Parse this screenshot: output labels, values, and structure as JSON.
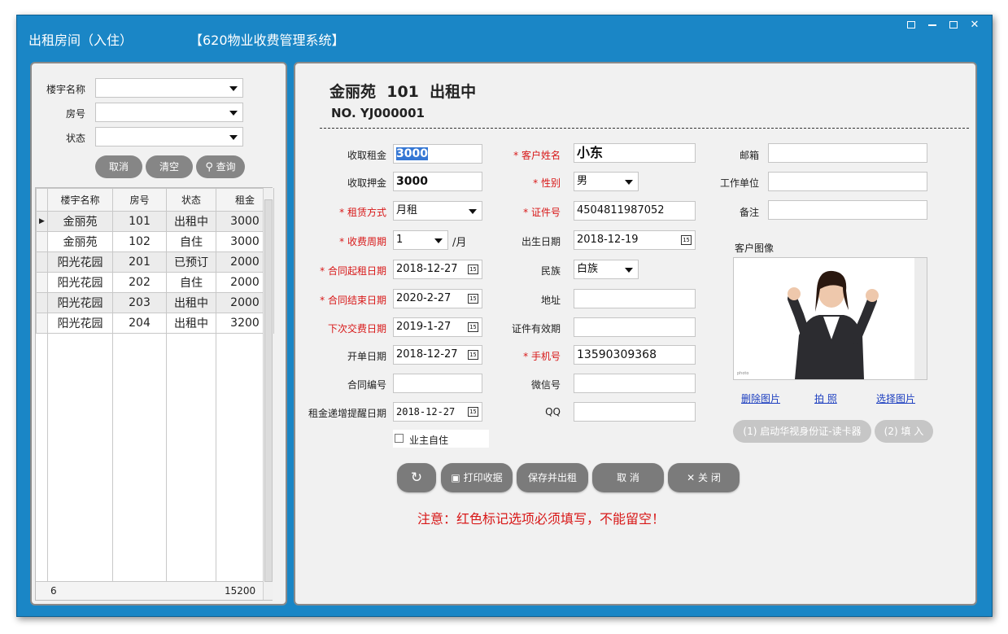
{
  "window": {
    "title": "出租房间（入住）",
    "system": "【620物业收费管理系统】"
  },
  "filter": {
    "building_label": "楼宇名称",
    "room_label": "房号",
    "status_label": "状态",
    "building_value": "",
    "room_value": "",
    "status_value": "",
    "cancel_label": "取消",
    "clear_label": "清空",
    "query_label": "查询"
  },
  "table": {
    "columns": [
      "楼宇名称",
      "房号",
      "状态",
      "租金"
    ],
    "rows": [
      [
        "金丽苑",
        "101",
        "出租中",
        "3000"
      ],
      [
        "金丽苑",
        "102",
        "自住",
        "3000"
      ],
      [
        "阳光花园",
        "201",
        "已预订",
        "2000"
      ],
      [
        "阳光花园",
        "202",
        "自住",
        "2000"
      ],
      [
        "阳光花园",
        "203",
        "出租中",
        "2000"
      ],
      [
        "阳光花园",
        "204",
        "出租中",
        "3200"
      ]
    ],
    "footer_count": "6",
    "footer_total": "15200"
  },
  "header": {
    "title": "金丽苑  101  出租中",
    "number": "NO. YJ000001"
  },
  "form": {
    "rent_label": "收取租金",
    "rent_value": "3000",
    "deposit_label": "收取押金",
    "deposit_value": "3000",
    "lease_type_label": "* 租赁方式",
    "lease_type_value": "月租",
    "cycle_label": "* 收费周期",
    "cycle_value": "1",
    "cycle_unit": "/月",
    "contract_start_label": "* 合同起租日期",
    "contract_start_value": "2018-12-27",
    "contract_end_label": "* 合同结束日期",
    "contract_end_value": "2020-2-27",
    "next_pay_label": "下次交费日期",
    "next_pay_value": "2019-1-27",
    "open_date_label": "开单日期",
    "open_date_value": "2018-12-27",
    "contract_no_label": "合同编号",
    "contract_no_value": "",
    "rent_remind_label": "租金递增提醒日期",
    "rent_remind_value": "2018-12-27",
    "owner_self_label": "业主自住",
    "customer_name_label": "* 客户姓名",
    "customer_name_value": "小东",
    "gender_label": "* 性别",
    "gender_value": "男",
    "id_label": "* 证件号",
    "id_value": "4504811987052",
    "birth_label": "出生日期",
    "birth_value": "2018-12-19",
    "ethnic_label": "民族",
    "ethnic_value": "白族",
    "address_label": "地址",
    "address_value": "",
    "id_valid_label": "证件有效期",
    "id_valid_value": "",
    "phone_label": "* 手机号",
    "phone_value": "13590309368",
    "wechat_label": "微信号",
    "wechat_value": "",
    "qq_label": "QQ",
    "qq_value": "",
    "email_label": "邮箱",
    "email_value": "",
    "workplace_label": "工作单位",
    "workplace_value": "",
    "remark_label": "备注",
    "remark_value": "",
    "photo_label": "客户图像"
  },
  "photo_actions": {
    "delete_label": "删除图片",
    "shoot_label": "拍 照",
    "choose_label": "选择图片",
    "read_id_label": "(1) 启动华视身份证-读卡器",
    "fill_label": "(2) 填 入"
  },
  "actions": {
    "print_label": "打印收据",
    "save_label": "保存并出租",
    "cancel_label": "取 消",
    "close_label": "关 闭"
  },
  "notice": "注意：红色标记选项必须填写，不能留空！",
  "colors": {
    "title_bar": "#1a86c6",
    "required": "#d81818",
    "button": "#7b7b7b",
    "link": "#1d3fc0"
  },
  "icons": [
    "refresh-icon",
    "print-icon",
    "close-x-icon",
    "search-icon",
    "calendar-icon",
    "dropdown-arrow-icon"
  ]
}
